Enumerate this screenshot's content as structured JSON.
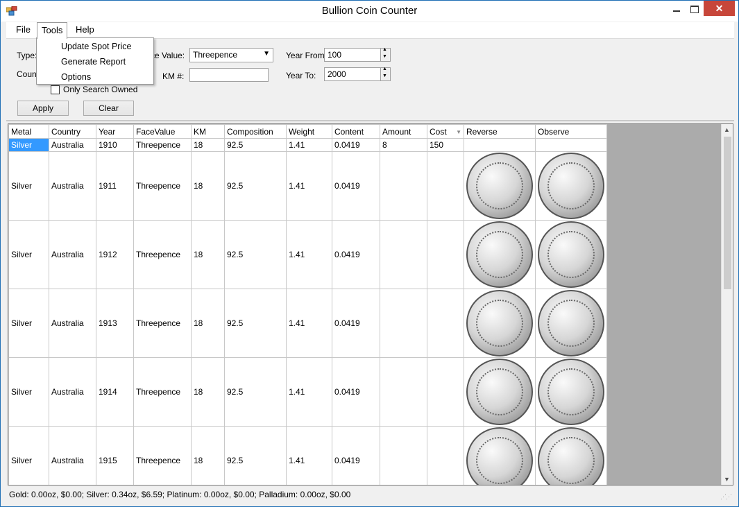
{
  "window": {
    "title": "Bullion Coin Counter"
  },
  "menu": {
    "file": "File",
    "tools": "Tools",
    "help": "Help"
  },
  "tools_menu": {
    "items": [
      "Update Spot Price",
      "Generate Report",
      "Options"
    ]
  },
  "filters": {
    "type_label": "Type:",
    "country_label": "Count",
    "face_value_label": "ce Value:",
    "face_value": "Threepence",
    "km_label": "KM #:",
    "km_value": "",
    "year_from_label": "Year From:",
    "year_from": "100",
    "year_to_label": "Year To:",
    "year_to": "2000",
    "only_owned_label": "Only Search Owned",
    "apply_label": "Apply",
    "clear_label": "Clear"
  },
  "grid": {
    "columns": [
      "Metal",
      "Country",
      "Year",
      "FaceValue",
      "KM",
      "Composition",
      "Weight",
      "Content",
      "Amount",
      "Cost",
      "Reverse",
      "Observe"
    ],
    "rows": [
      [
        "Silver",
        "Australia",
        "1910",
        "Threepence",
        "18",
        "92.5",
        "1.41",
        "0.0419",
        "8",
        "150"
      ],
      [
        "Silver",
        "Australia",
        "1911",
        "Threepence",
        "18",
        "92.5",
        "1.41",
        "0.0419",
        "",
        ""
      ],
      [
        "Silver",
        "Australia",
        "1912",
        "Threepence",
        "18",
        "92.5",
        "1.41",
        "0.0419",
        "",
        ""
      ],
      [
        "Silver",
        "Australia",
        "1913",
        "Threepence",
        "18",
        "92.5",
        "1.41",
        "0.0419",
        "",
        ""
      ],
      [
        "Silver",
        "Australia",
        "1914",
        "Threepence",
        "18",
        "92.5",
        "1.41",
        "0.0419",
        "",
        ""
      ],
      [
        "Silver",
        "Australia",
        "1915",
        "Threepence",
        "18",
        "92.5",
        "1.41",
        "0.0419",
        "",
        ""
      ]
    ]
  },
  "status": {
    "text": "Gold: 0.00oz, $0.00; Silver: 0.34oz, $6.59; Platinum: 0.00oz, $0.00; Palladium: 0.00oz, $0.00"
  }
}
